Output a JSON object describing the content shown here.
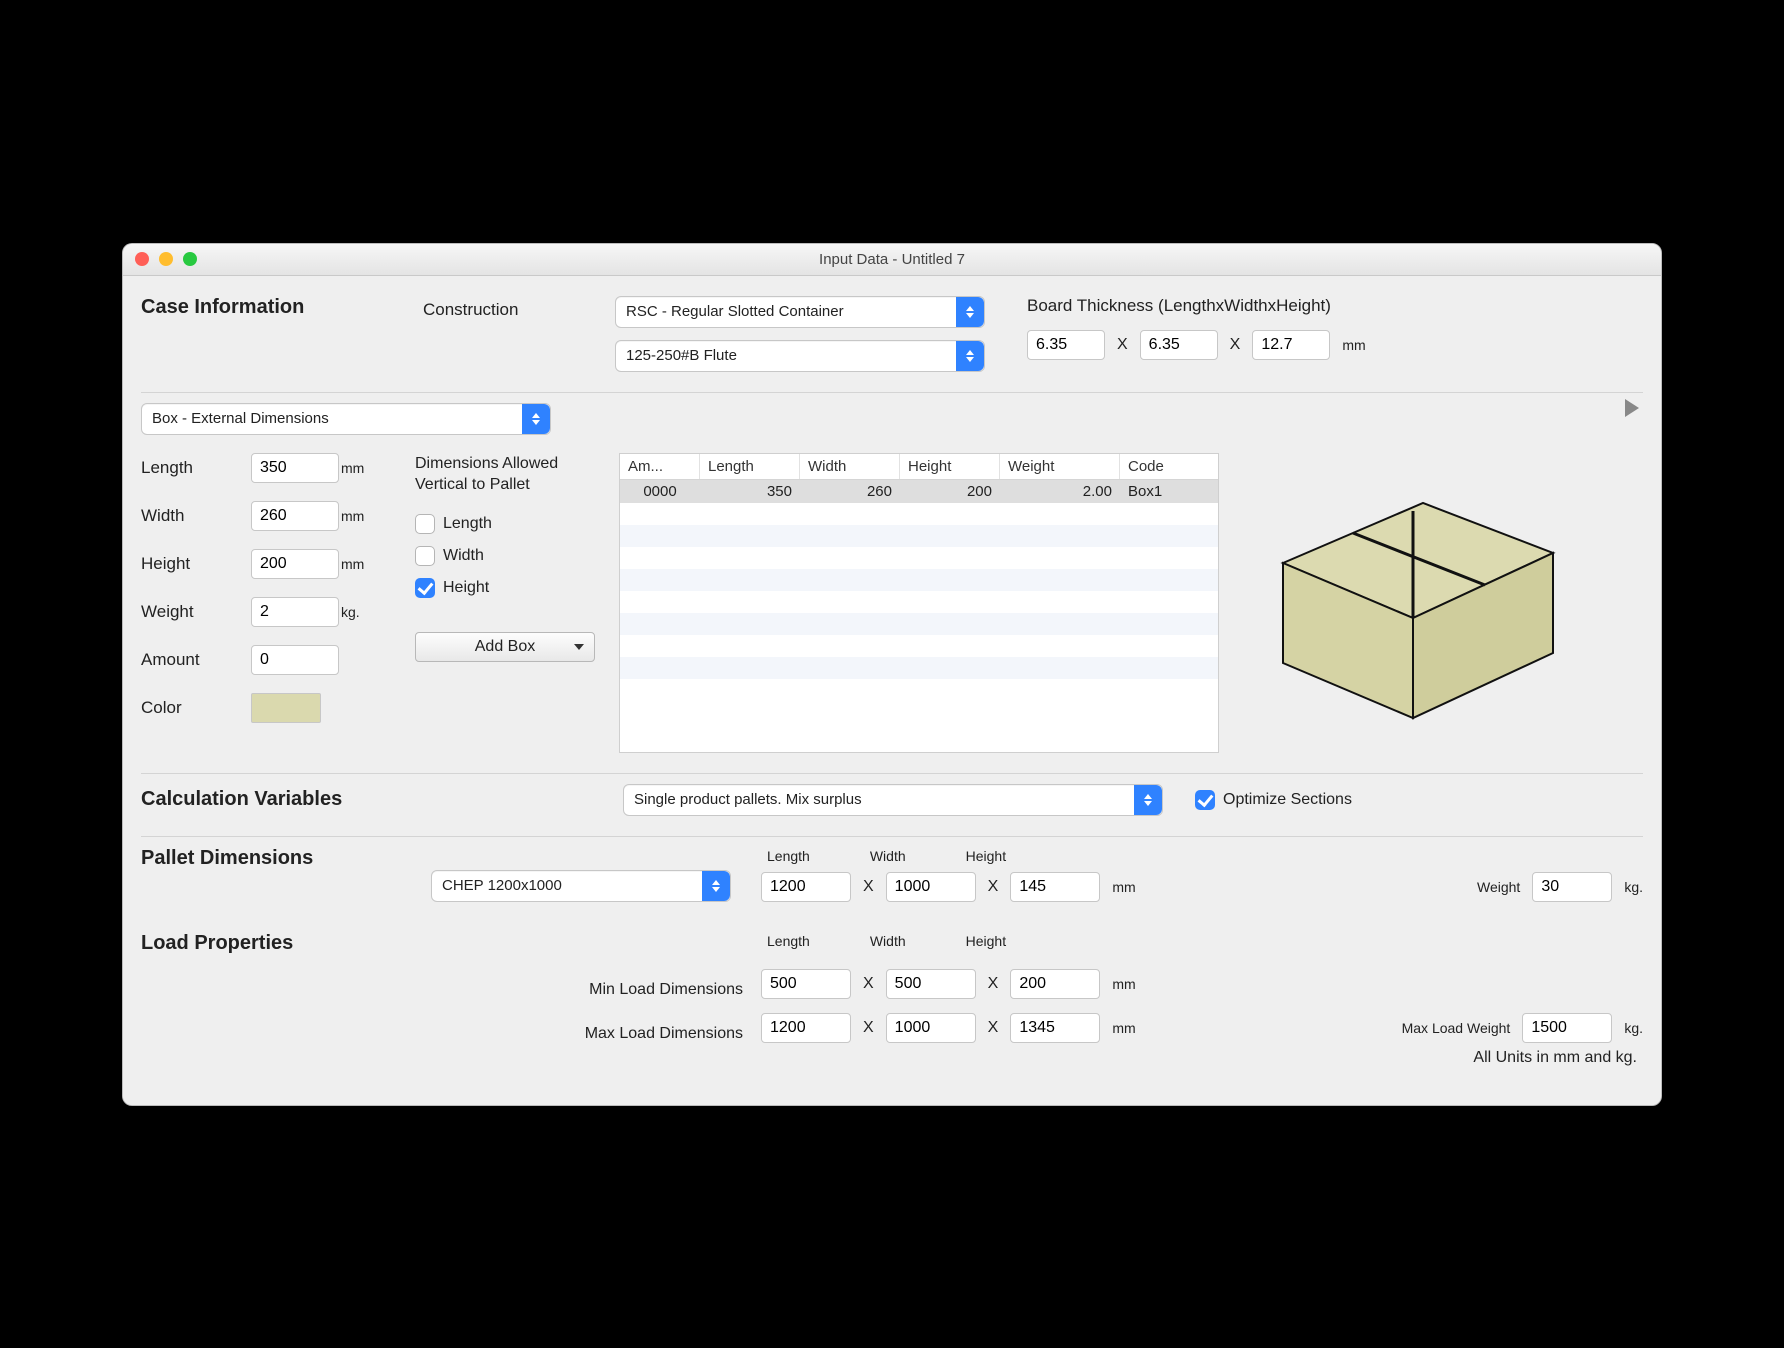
{
  "window": {
    "title": "Input Data - Untitled 7"
  },
  "caseInfo": {
    "heading": "Case Information",
    "constructionLabel": "Construction",
    "constructionValue": "RSC - Regular Slotted Container",
    "fluteValue": "125-250#B Flute",
    "boardThicknessLabel": "Board Thickness (LengthxWidthxHeight)",
    "bt_length": "6.35",
    "bt_width": "6.35",
    "bt_height": "12.7",
    "bt_unit": "mm",
    "x": "X"
  },
  "boxPanel": {
    "dimModeValue": "Box - External Dimensions",
    "lengthLabel": "Length",
    "lengthValue": "350",
    "lenUnit": "mm",
    "widthLabel": "Width",
    "widthValue": "260",
    "widUnit": "mm",
    "heightLabel": "Height",
    "heightValue": "200",
    "hgtUnit": "mm",
    "weightLabel": "Weight",
    "weightValue": "2",
    "wgtUnit": "kg.",
    "amountLabel": "Amount",
    "amountValue": "0",
    "colorLabel": "Color",
    "allowedHeading": "Dimensions Allowed Vertical to Pallet",
    "chkLength": "Length",
    "chkWidth": "Width",
    "chkHeight": "Height",
    "addBoxLabel": "Add Box",
    "colorHex": "#dad9ae"
  },
  "boxTable": {
    "headers": {
      "am": "Am...",
      "length": "Length",
      "width": "Width",
      "height": "Height",
      "weight": "Weight",
      "code": "Code"
    },
    "rows": [
      {
        "am": "0000",
        "length": "350",
        "width": "260",
        "height": "200",
        "weight": "2.00",
        "code": "Box1"
      }
    ]
  },
  "calcVars": {
    "heading": "Calculation Variables",
    "modeValue": "Single product pallets. Mix surplus",
    "optimizeLabel": "Optimize Sections"
  },
  "pallet": {
    "heading": "Pallet Dimensions",
    "typeValue": "CHEP 1200x1000",
    "lengthLabel": "Length",
    "widthLabel": "Width",
    "heightLabel": "Height",
    "length": "1200",
    "width": "1000",
    "height": "145",
    "unit": "mm",
    "weightLabel": "Weight",
    "weight": "30",
    "wUnit": "kg.",
    "x": "X"
  },
  "load": {
    "heading": "Load Properties",
    "lengthLabel": "Length",
    "widthLabel": "Width",
    "heightLabel": "Height",
    "minLabel": "Min Load Dimensions",
    "minL": "500",
    "minW": "500",
    "minH": "200",
    "unit": "mm",
    "maxLabel": "Max Load Dimensions",
    "maxL": "1200",
    "maxW": "1000",
    "maxH": "1345",
    "maxWeightLabel": "Max Load Weight",
    "maxWeight": "1500",
    "wUnit": "kg.",
    "x": "X"
  },
  "footer": {
    "unitsNote": "All Units in mm and kg."
  }
}
